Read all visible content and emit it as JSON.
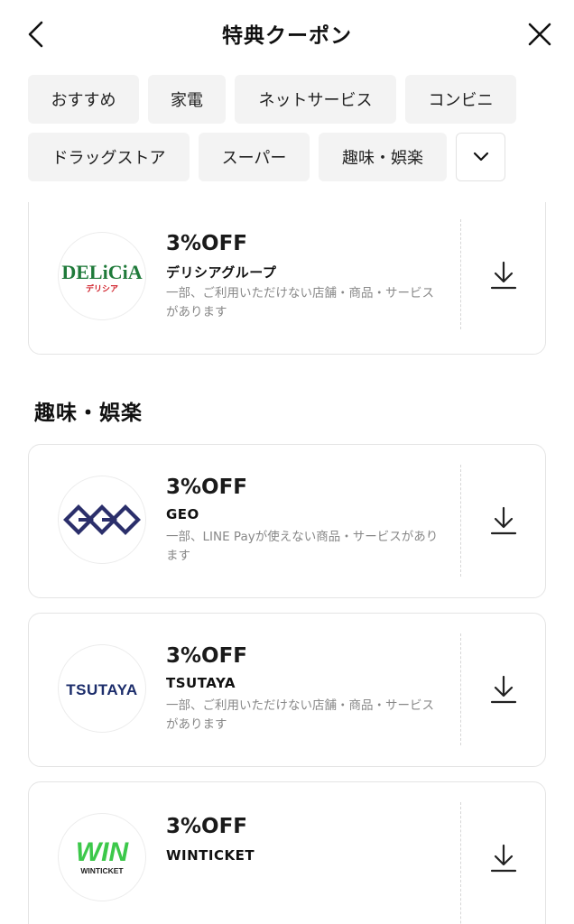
{
  "header": {
    "title": "特典クーポン"
  },
  "categories": [
    {
      "label": "おすすめ"
    },
    {
      "label": "家電"
    },
    {
      "label": "ネットサービス"
    },
    {
      "label": "コンビニ"
    },
    {
      "label": "ドラッグストア"
    },
    {
      "label": "スーパー"
    },
    {
      "label": "趣味・娯楽"
    }
  ],
  "sections": {
    "hobby_title": "趣味・娯楽"
  },
  "coupons": [
    {
      "discount": "3%OFF",
      "store": "デリシアグループ",
      "note": "一部、ご利用いただけない店舗・商品・サービスがあります",
      "logo_text": "DELiCiA",
      "logo_subtext": "デリシア"
    },
    {
      "discount": "3%OFF",
      "store": "GEO",
      "note": "一部、LINE Payが使えない商品・サービスがあります",
      "logo_text": "GEO"
    },
    {
      "discount": "3%OFF",
      "store": "TSUTAYA",
      "note": "一部、ご利用いただけない店舗・商品・サービスがあります",
      "logo_text": "TSUTAYA"
    },
    {
      "discount": "3%OFF",
      "store": "WINTICKET",
      "note": "",
      "logo_text": "WIN",
      "logo_subtext": "WINTICKET"
    }
  ],
  "colors": {
    "delicia_green": "#1f7a3a",
    "delicia_red": "#d0202a",
    "geo_navy": "#2b2f6b",
    "tsutaya_navy": "#1c2d6b",
    "winticket_green": "#3cc84a"
  }
}
